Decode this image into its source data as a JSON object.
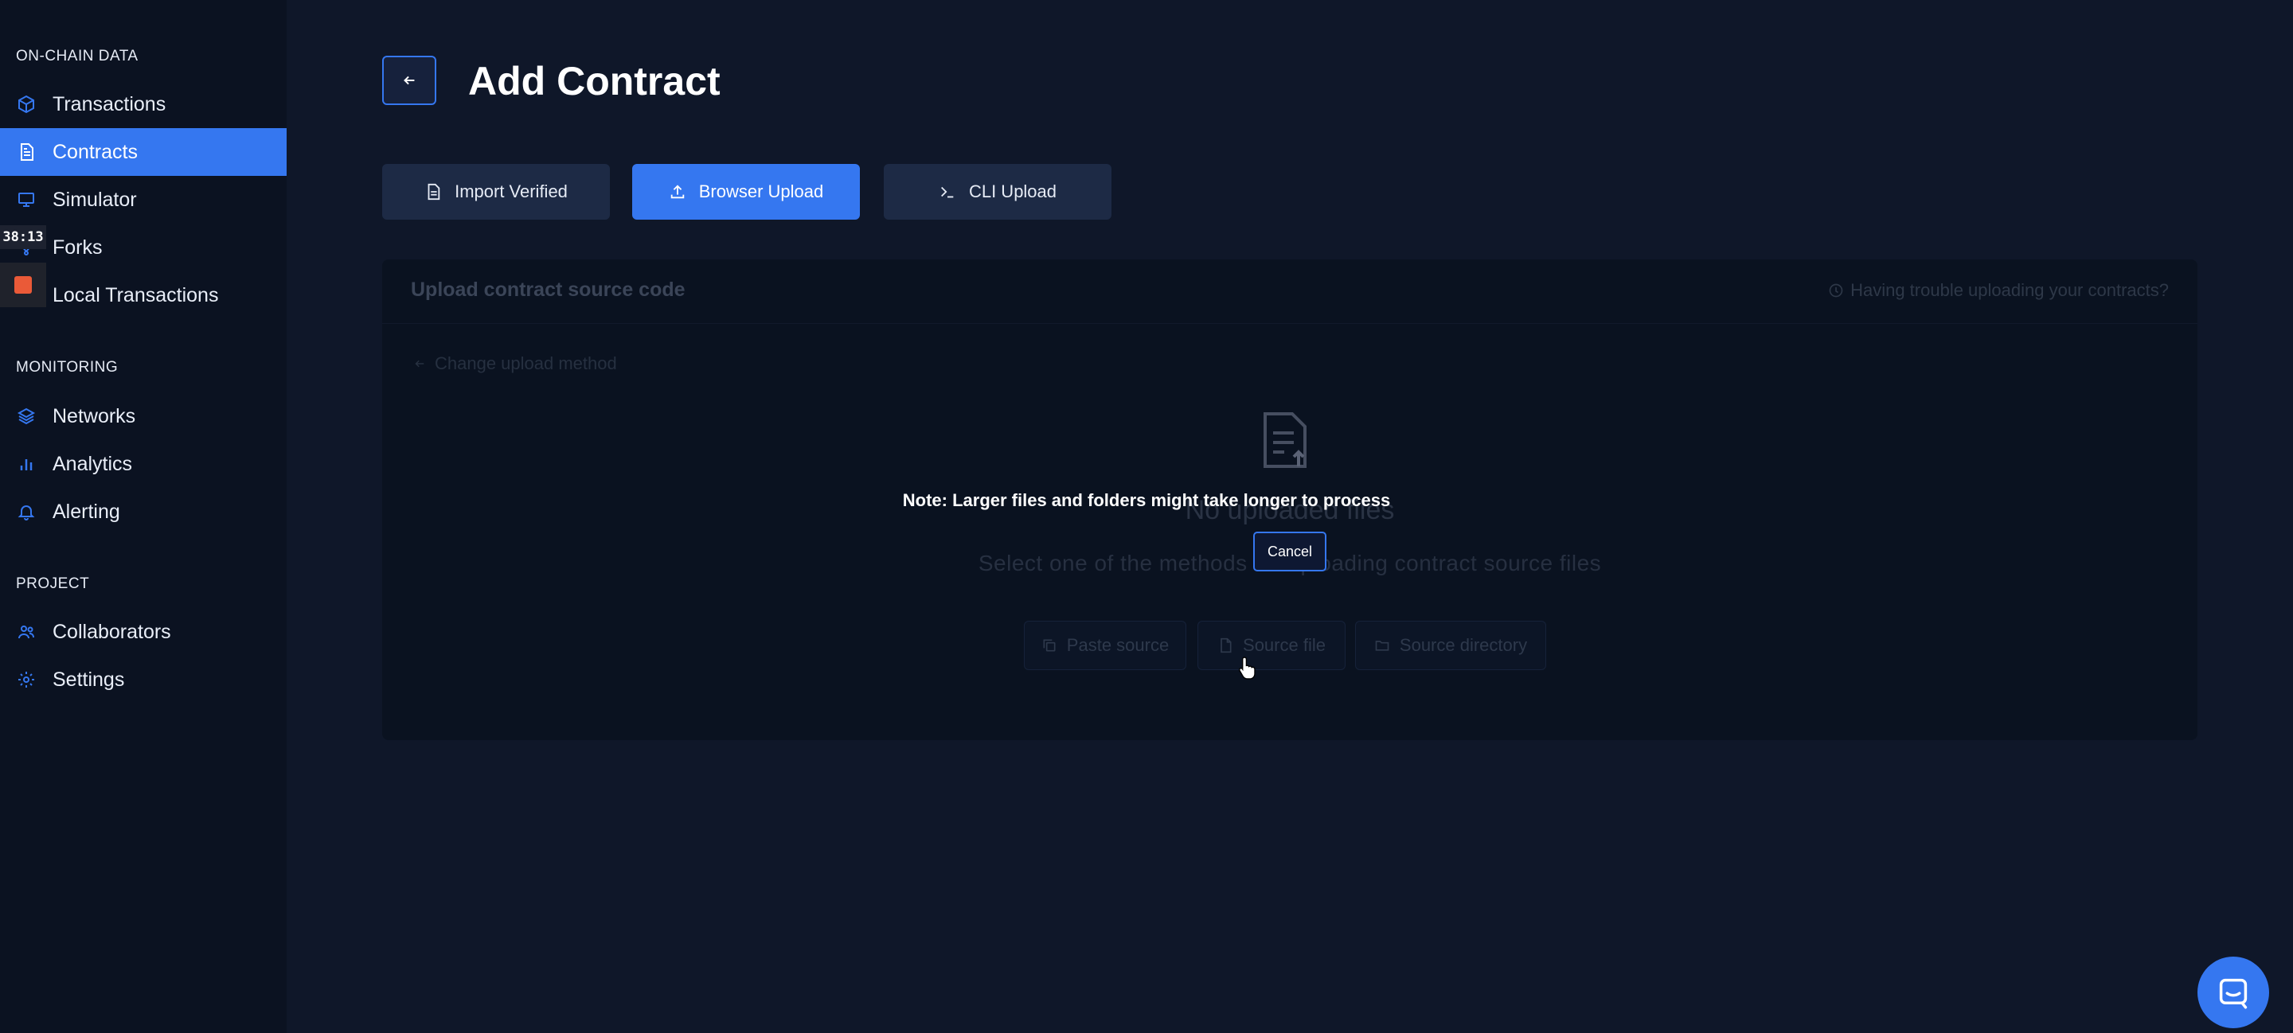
{
  "sidebar": {
    "sections": [
      {
        "label": "ON-CHAIN DATA"
      },
      {
        "label": "MONITORING"
      },
      {
        "label": "PROJECT"
      }
    ],
    "items": [
      {
        "label": "Transactions",
        "icon": "cube-icon"
      },
      {
        "label": "Contracts",
        "icon": "document-icon",
        "active": true
      },
      {
        "label": "Simulator",
        "icon": "monitor-icon"
      },
      {
        "label": "Forks",
        "icon": "fork-icon"
      },
      {
        "label": "Local Transactions",
        "icon": "terminal-icon"
      },
      {
        "label": "Networks",
        "icon": "layers-icon"
      },
      {
        "label": "Analytics",
        "icon": "bar-chart-icon"
      },
      {
        "label": "Alerting",
        "icon": "bell-icon"
      },
      {
        "label": "Collaborators",
        "icon": "users-icon"
      },
      {
        "label": "Settings",
        "icon": "gear-icon"
      }
    ]
  },
  "recorder": {
    "time": "38:13"
  },
  "header": {
    "title": "Add Contract"
  },
  "methods": [
    {
      "label": "Import Verified",
      "icon": "document-icon"
    },
    {
      "label": "Browser Upload",
      "icon": "upload-icon",
      "active": true
    },
    {
      "label": "CLI Upload",
      "icon": "terminal-icon"
    }
  ],
  "panel": {
    "title": "Upload contract source code",
    "help": "Having trouble uploading your contracts?",
    "change_method": "Change upload method",
    "empty_title": "No uploaded files",
    "empty_subtitle": "Select one of the methods for uploading contract source files",
    "buttons": [
      {
        "label": "Paste source",
        "icon": "copy-icon"
      },
      {
        "label": "Source file",
        "icon": "file-icon"
      },
      {
        "label": "Source directory",
        "icon": "folder-icon"
      }
    ]
  },
  "overlay": {
    "note": "Note: Larger files and folders might take longer to process",
    "cancel_label": "Cancel"
  },
  "colors": {
    "accent": "#3577f0",
    "background": "#0f1729",
    "sidebar": "#0b1221",
    "recorder_stop": "#ea5a38"
  }
}
